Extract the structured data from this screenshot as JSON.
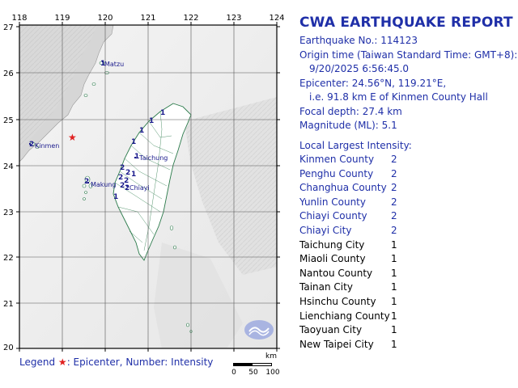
{
  "map": {
    "lon_ticks": [
      "118",
      "119",
      "120",
      "121",
      "122",
      "123",
      "124"
    ],
    "lat_ticks": [
      "27",
      "26",
      "25",
      "24",
      "23",
      "22",
      "21",
      "20"
    ],
    "place_labels": {
      "matsu": "Matzu",
      "kinmen": "Kinmen",
      "makung": "Makung",
      "taichung": "Taichung",
      "chiayi": "Chiayi"
    },
    "intensity_marks": [
      {
        "value": "2",
        "place": "Kinmen"
      },
      {
        "value": "1",
        "place": "Matzu"
      },
      {
        "value": "2",
        "place": "Makung"
      },
      {
        "value": "1",
        "place": "Taichung"
      },
      {
        "value": "2",
        "place": "Changhua"
      },
      {
        "value": "2",
        "place": "Changhua"
      },
      {
        "value": "2",
        "place": "Yunlin"
      },
      {
        "value": "2",
        "place": "Yunlin"
      },
      {
        "value": "2",
        "place": "Chiayi"
      },
      {
        "value": "2",
        "place": "Chiayi City"
      },
      {
        "value": "1",
        "place": "Nantou"
      },
      {
        "value": "1",
        "place": "Tainan"
      },
      {
        "value": "1",
        "place": "Miaoli"
      },
      {
        "value": "1",
        "place": "Hsinchu"
      },
      {
        "value": "1",
        "place": "Taoyuan"
      },
      {
        "value": "1",
        "place": "New Taipei"
      }
    ],
    "epicenter_symbol": "★",
    "epicenter_color": "#e02020"
  },
  "legend": {
    "prefix": "Legend",
    "star": "★",
    "text": ": Epicenter, Number: Intensity"
  },
  "scale": {
    "unit": "km",
    "labels": [
      "0",
      "50",
      "100"
    ]
  },
  "report": {
    "title": "CWA EARTHQUAKE REPORT",
    "number_line": "Earthquake No.: 114123",
    "origin_line": "Origin time (Taiwan Standard Time: GMT+8):",
    "origin_value": "9/20/2025   6:56:45.0",
    "epicenter_line": "Epicenter: 24.56°N, 119.21°E,",
    "epicenter_ref": "i.e. 91.8 km E of Kinmen County Hall",
    "depth_line": "Focal depth: 27.4 km",
    "magnitude_line": "Magnitude (ML): 5.1",
    "intensity_heading": "Local Largest Intensity:",
    "intensities": [
      {
        "name": "Kinmen County",
        "value": "2",
        "color": "#1f2fa8"
      },
      {
        "name": "Penghu County",
        "value": "2",
        "color": "#1f2fa8"
      },
      {
        "name": "Changhua County",
        "value": "2",
        "color": "#1f2fa8"
      },
      {
        "name": "Yunlin County",
        "value": "2",
        "color": "#1f2fa8"
      },
      {
        "name": "Chiayi County",
        "value": "2",
        "color": "#1f2fa8"
      },
      {
        "name": "Chiayi City",
        "value": "2",
        "color": "#1f2fa8"
      },
      {
        "name": "Taichung City",
        "value": "1",
        "color": "#000000"
      },
      {
        "name": "Miaoli County",
        "value": "1",
        "color": "#000000"
      },
      {
        "name": "Nantou County",
        "value": "1",
        "color": "#000000"
      },
      {
        "name": "Tainan City",
        "value": "1",
        "color": "#000000"
      },
      {
        "name": "Hsinchu County",
        "value": "1",
        "color": "#000000"
      },
      {
        "name": "Lienchiang County",
        "value": "1",
        "color": "#000000"
      },
      {
        "name": "Taoyuan City",
        "value": "1",
        "color": "#000000"
      },
      {
        "name": "New Taipei City",
        "value": "1",
        "color": "#000000"
      }
    ]
  },
  "colors": {
    "accent_blue": "#1f2fa8",
    "epicenter_red": "#e02020",
    "coast_green": "#2a7a4a"
  }
}
